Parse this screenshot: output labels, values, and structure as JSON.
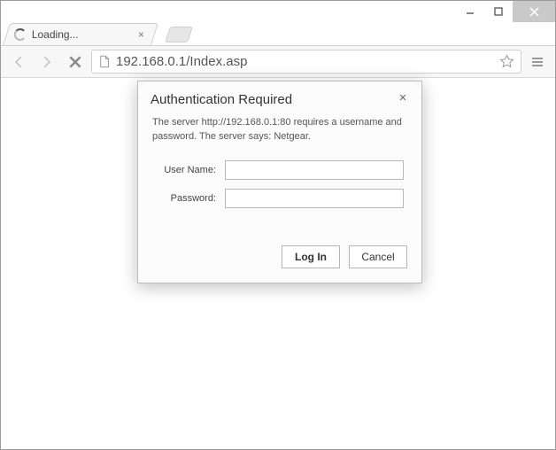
{
  "window": {
    "minimize": "–",
    "maximize": "□",
    "close": "×"
  },
  "tab": {
    "title": "Loading..."
  },
  "toolbar": {
    "url": "192.168.0.1/Index.asp"
  },
  "dialog": {
    "title": "Authentication Required",
    "message": "The server http://192.168.0.1:80 requires a username and password. The server says: Netgear.",
    "username_label": "User Name:",
    "password_label": "Password:",
    "username_value": "",
    "password_value": "",
    "login_label": "Log In",
    "cancel_label": "Cancel"
  }
}
